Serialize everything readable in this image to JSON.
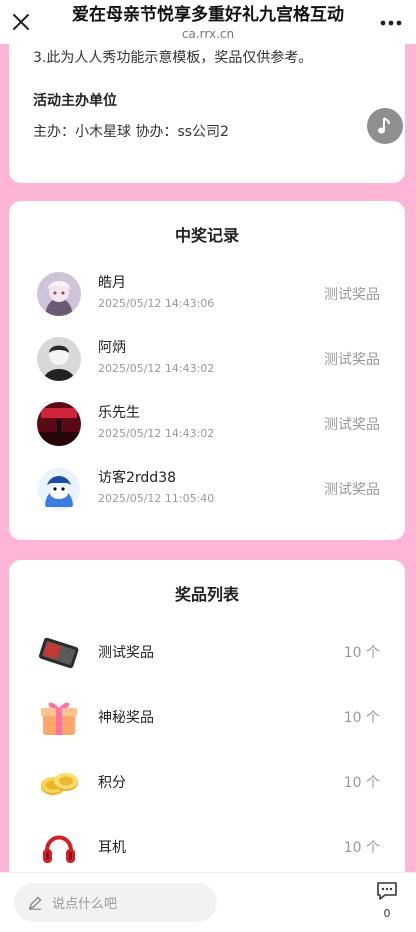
{
  "header": {
    "title": "爱在母亲节悦享多重好礼九宫格互动",
    "domain": "ca.rrx.cn"
  },
  "info": {
    "note": "3.此为人人秀功能示意模板，奖品仅供参考。",
    "organizer_heading": "活动主办单位",
    "organizer_text": "主办：小木星球 协办：ss公司2"
  },
  "records": {
    "title": "中奖记录",
    "items": [
      {
        "name": "皓月",
        "time": "2025/05/12 14:43:06",
        "prize": "测试奖品"
      },
      {
        "name": "阿炳",
        "time": "2025/05/12 14:43:02",
        "prize": "测试奖品"
      },
      {
        "name": "乐先生",
        "time": "2025/05/12 14:43:02",
        "prize": "测试奖品"
      },
      {
        "name": "访客2rdd38",
        "time": "2025/05/12 11:05:40",
        "prize": "测试奖品"
      }
    ]
  },
  "prizes": {
    "title": "奖品列表",
    "items": [
      {
        "name": "测试奖品",
        "count": "10 个",
        "icon": "tablet-icon"
      },
      {
        "name": "神秘奖品",
        "count": "10 个",
        "icon": "gift-box-icon"
      },
      {
        "name": "积分",
        "count": "10 个",
        "icon": "coins-icon"
      },
      {
        "name": "耳机",
        "count": "10 个",
        "icon": "headphones-icon"
      }
    ]
  },
  "bottom": {
    "comment_placeholder": "说点什么吧",
    "comment_count": "0"
  },
  "colors": {
    "background": "#ffb6d6",
    "music_button": "#8f8f8f"
  }
}
